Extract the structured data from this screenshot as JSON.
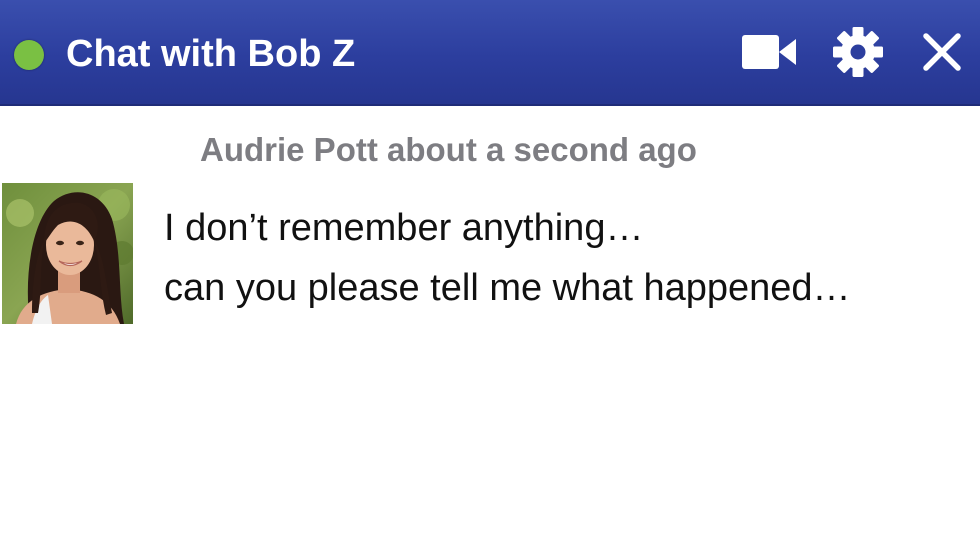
{
  "header": {
    "title": "Chat with Bob Z",
    "status": "online",
    "status_color": "#7ac043",
    "background_color": "#2c3e9e",
    "icons": [
      "video-camera-icon",
      "gear-icon",
      "close-icon"
    ]
  },
  "conversation": {
    "messages": [
      {
        "sender": "Audrie Pott",
        "timestamp": "about a second ago",
        "lines": [
          "I don’t remember anything…",
          "can you please tell me what happened…"
        ]
      }
    ]
  }
}
